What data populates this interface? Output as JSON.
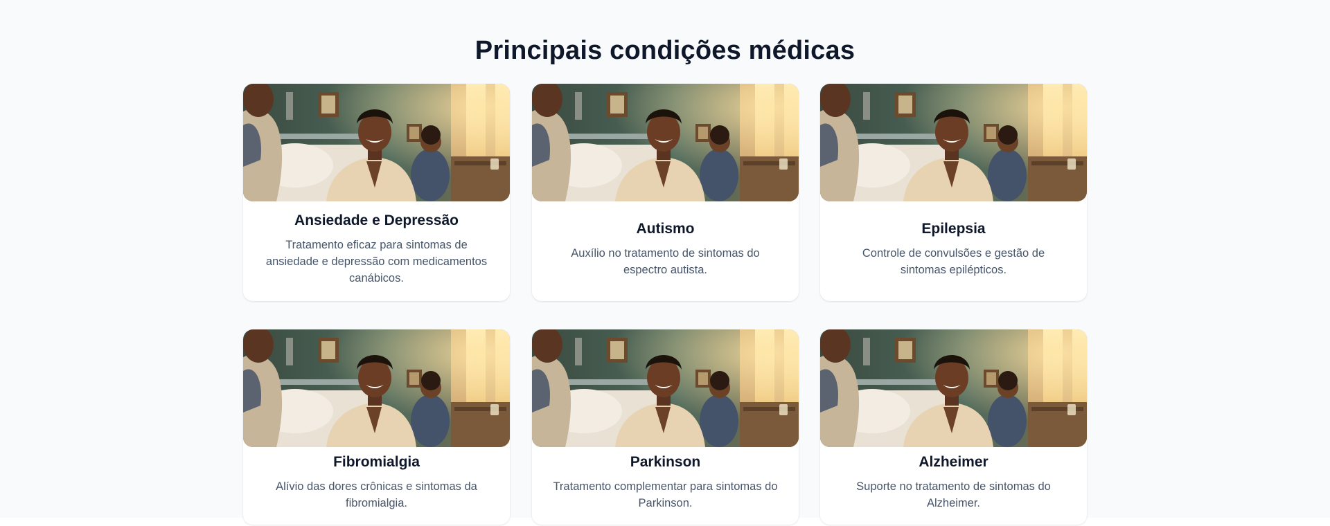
{
  "section": {
    "title": "Principais condições médicas"
  },
  "cards": [
    {
      "title": "Ansiedade e Depressão",
      "description": "Tratamento eficaz para sintomas de ansiedade e depressão com medicamentos canábicos.",
      "image": "smiling-patient-photo"
    },
    {
      "title": "Autismo",
      "description": "Auxílio no tratamento de sintomas do espectro autista.",
      "image": "smiling-patient-photo"
    },
    {
      "title": "Epilepsia",
      "description": "Controle de convulsões e gestão de sintomas epilépticos.",
      "image": "smiling-patient-photo"
    },
    {
      "title": "Fibromialgia",
      "description": "Alívio das dores crônicas e sintomas da fibromialgia.",
      "image": "smiling-patient-photo"
    },
    {
      "title": "Parkinson",
      "description": "Tratamento complementar para sintomas do Parkinson.",
      "image": "smiling-patient-photo"
    },
    {
      "title": "Alzheimer",
      "description": "Suporte no tratamento de sintomas do Alzheimer.",
      "image": "smiling-patient-photo"
    }
  ],
  "colors": {
    "background": "#f8fafc",
    "card": "#ffffff",
    "heading": "#0f172a",
    "text": "#475569"
  }
}
